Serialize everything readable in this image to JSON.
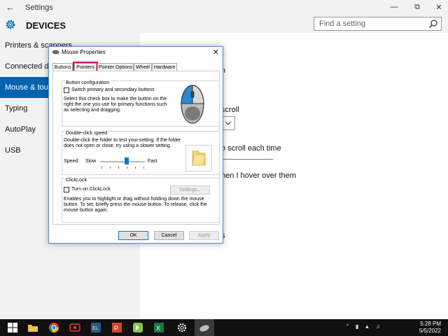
{
  "titlebar": {
    "title": "Settings",
    "back_icon": "back-arrow-icon"
  },
  "header": {
    "section_title": "DEVICES",
    "search_placeholder": "Find a setting"
  },
  "sidebar": {
    "items": [
      {
        "label": "Printers & scanners",
        "active": false
      },
      {
        "label": "Connected devices",
        "active": false
      },
      {
        "label": "Mouse & touchpad",
        "active": true
      },
      {
        "label": "Typing",
        "active": false
      },
      {
        "label": "AutoPlay",
        "active": false
      },
      {
        "label": "USB",
        "active": false
      }
    ]
  },
  "right_pane": {
    "text_1": "n",
    "text_2": "scroll",
    "text_3": "o scroll each time",
    "text_4": "hen I hover over them",
    "text_5": "s"
  },
  "dialog": {
    "title": "Mouse Properties",
    "tabs": [
      "Buttons",
      "Pointers",
      "Pointer Options",
      "Wheel",
      "Hardware"
    ],
    "selected_tab": "Buttons",
    "highlighted_tab": "Pointers",
    "button_config": {
      "label": "Button configuration",
      "checkbox_label": "Switch primary and secondary buttons",
      "description": "Select this check box to make the button on the right the one you use for primary functions such as selecting and dragging.",
      "checked": false
    },
    "double_click": {
      "label": "Double-click speed",
      "description": "Double-click the folder to test your setting. If the folder does not open or close, try using a slower setting.",
      "speed_label": "Speed:",
      "slow_label": "Slow",
      "fast_label": "Fast",
      "speed_level": 0.6
    },
    "clicklock": {
      "label": "ClickLock",
      "checkbox_label": "Turn on ClickLock",
      "settings_button": "Settings...",
      "description": "Enables you to highlight or drag without holding down the mouse button. To set, briefly press the mouse button. To release, click the mouse button again.",
      "checked": false
    },
    "buttons": {
      "ok": "OK",
      "cancel": "Cancel",
      "apply": "Apply"
    }
  },
  "taskbar": {
    "time": "5:28 PM",
    "date": "5/5/2022",
    "apps": [
      "windows-start-icon",
      "file-explorer-icon",
      "chrome-icon",
      "media-app-icon",
      "word-el-icon",
      "powerpoint-icon",
      "green-app-icon",
      "excel-icon",
      "settings-icon",
      "mouse-app-icon"
    ]
  },
  "colors": {
    "accent": "#0063b1",
    "highlight": "#e0007a",
    "taskbar": "#101010"
  }
}
